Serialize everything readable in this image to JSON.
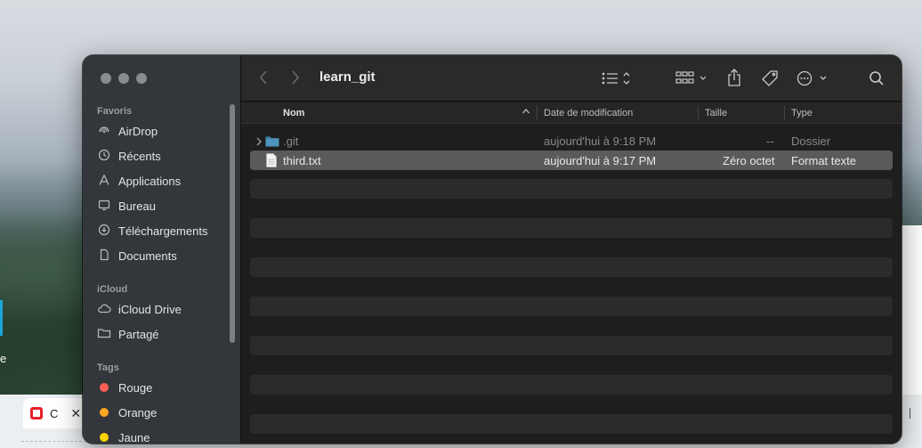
{
  "browser": {
    "tab_label": "C",
    "tab_close": "✕"
  },
  "desktop": {
    "left_text": "e"
  },
  "finder": {
    "toolbar": {
      "back_icon": "chevron-left-icon",
      "forward_icon": "chevron-right-icon",
      "folder_title": "learn_git",
      "list_view_icon": "list-icon",
      "group_icon": "grid-icon",
      "share_icon": "share-icon",
      "tag_icon": "tag-icon",
      "more_icon": "ellipsis-icon",
      "search_icon": "search-icon"
    },
    "sidebar": {
      "favorites_header": "Favoris",
      "favorites": [
        {
          "label": "AirDrop",
          "icon": "airdrop-icon"
        },
        {
          "label": "Récents",
          "icon": "clock-icon"
        },
        {
          "label": "Applications",
          "icon": "applications-icon"
        },
        {
          "label": "Bureau",
          "icon": "desktop-icon"
        },
        {
          "label": "Téléchargements",
          "icon": "download-icon"
        },
        {
          "label": "Documents",
          "icon": "document-icon"
        }
      ],
      "icloud_header": "iCloud",
      "icloud": [
        {
          "label": "iCloud Drive",
          "icon": "cloud-icon"
        },
        {
          "label": "Partagé",
          "icon": "shared-folder-icon"
        }
      ],
      "tags_header": "Tags",
      "tags": [
        {
          "label": "Rouge",
          "color": "#ff5f57"
        },
        {
          "label": "Orange",
          "color": "#ffa724"
        },
        {
          "label": "Jaune",
          "color": "#ffd400"
        }
      ]
    },
    "columns": {
      "name": "Nom",
      "date": "Date de modification",
      "size": "Taille",
      "type": "Type"
    },
    "files": [
      {
        "name": ".git",
        "date": "aujourd'hui à 9:18 PM",
        "size": "--",
        "type": "Dossier",
        "kind": "folder"
      },
      {
        "name": "third.txt",
        "date": "aujourd'hui à 9:17 PM",
        "size": "Zéro octet",
        "type": "Format texte",
        "kind": "text"
      }
    ]
  }
}
